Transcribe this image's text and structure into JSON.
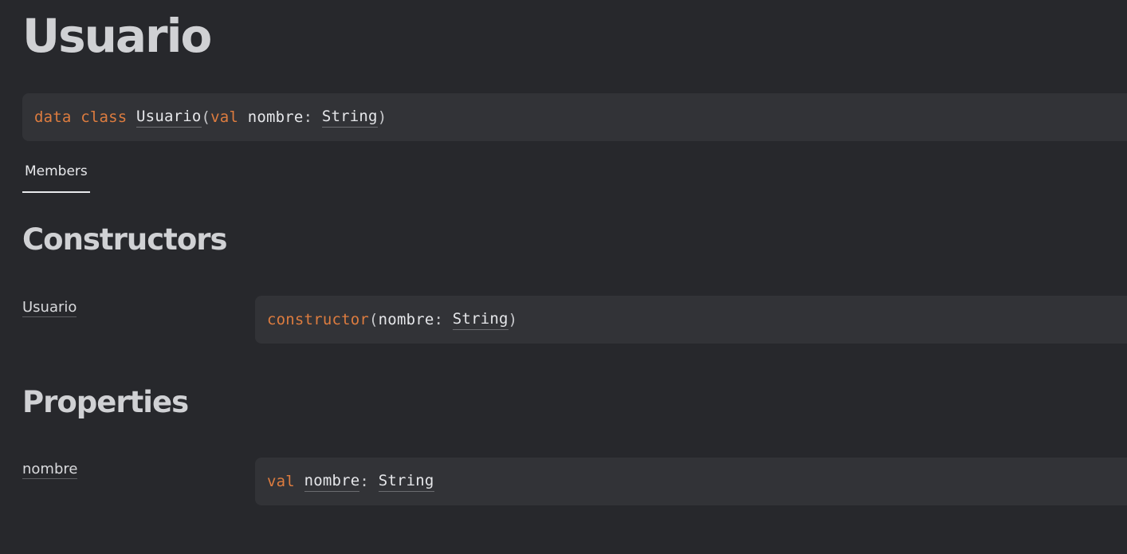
{
  "page": {
    "title": "Usuario"
  },
  "signature": {
    "kw_data": "data",
    "kw_class": "class",
    "class_name": "Usuario",
    "open_paren": "(",
    "kw_val": "val",
    "param_name": "nombre",
    "colon": ":",
    "param_type": "String",
    "close_paren": ")"
  },
  "tabs": [
    {
      "label": "Members",
      "active": true
    }
  ],
  "sections": {
    "constructors": {
      "title": "Constructors",
      "items": [
        {
          "name": "Usuario",
          "keyword": "constructor",
          "open_paren": "(",
          "param_name": "nombre",
          "colon": ":",
          "param_type": "String",
          "close_paren": ")"
        }
      ]
    },
    "properties": {
      "title": "Properties",
      "items": [
        {
          "name": "nombre",
          "keyword": "val",
          "prop_name": "nombre",
          "colon": ":",
          "prop_type": "String"
        }
      ]
    }
  },
  "colors": {
    "background": "#27282c",
    "code_background": "#323337",
    "keyword": "#dd7c3f",
    "text": "#d8d9dc"
  }
}
